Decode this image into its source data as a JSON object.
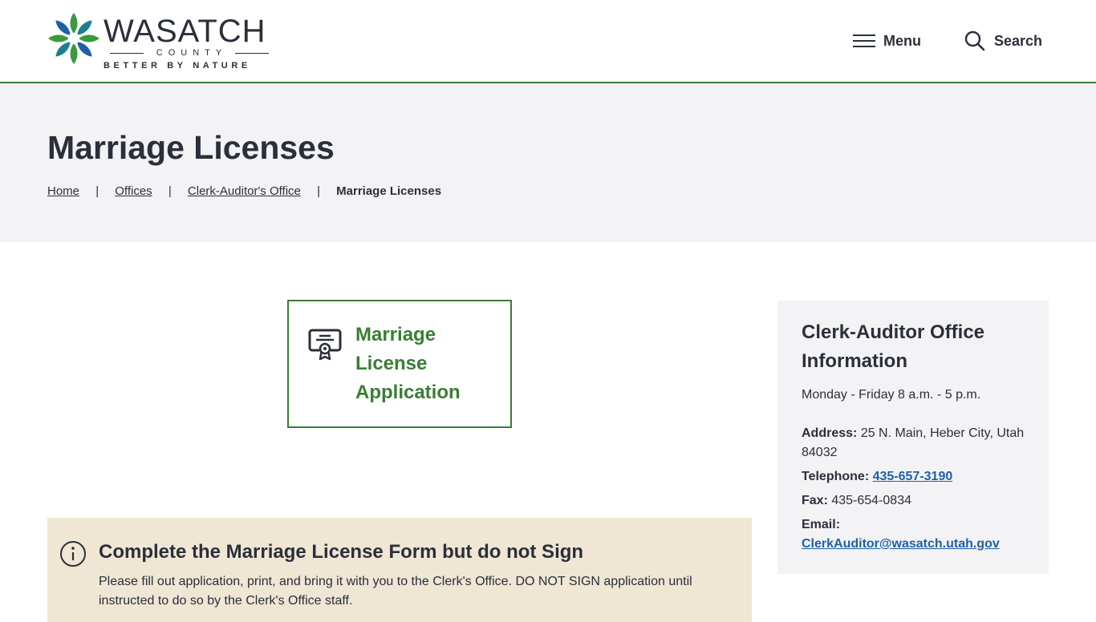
{
  "header": {
    "logo": {
      "title": "WASATCH",
      "county": "COUNTY",
      "tagline": "BETTER BY NATURE",
      "colors": {
        "green": "#3a9a3f",
        "teal": "#1b7f8e",
        "blue": "#1f5fa8"
      }
    },
    "menu_label": "Menu",
    "search_label": "Search"
  },
  "hero": {
    "title": "Marriage Licenses",
    "breadcrumb": [
      {
        "label": "Home"
      },
      {
        "label": "Offices"
      },
      {
        "label": "Clerk-Auditor's Office"
      },
      {
        "label": "Marriage Licenses"
      }
    ],
    "separator": "|"
  },
  "card": {
    "title": "Marriage License Application",
    "icon": "certificate-icon"
  },
  "notice": {
    "icon": "info-icon",
    "title": "Complete the Marriage License Form but do not Sign",
    "body": "Please fill out application, print, and bring it with you to the Clerk's Office. DO NOT SIGN application until instructed to do so by the Clerk's Office staff."
  },
  "sidebar": {
    "title": "Clerk-Auditor Office Information",
    "hours": "Monday - Friday 8 a.m. - 5 p.m.",
    "address_label": "Address:",
    "address_value": "25 N. Main, Heber City, Utah 84032",
    "telephone_label": "Telephone:",
    "telephone_value": "435-657-3190",
    "fax_label": "Fax:",
    "fax_value": "435-654-0834",
    "email_label": "Email:",
    "email_value": "ClerkAuditor@wasatch.utah.gov"
  },
  "colors": {
    "accent_green": "#3a7d35",
    "link_blue": "#1f5fa8",
    "hero_bg": "#f3f3f5",
    "notice_bg": "#efe6d4",
    "text": "#2a2f3a"
  }
}
